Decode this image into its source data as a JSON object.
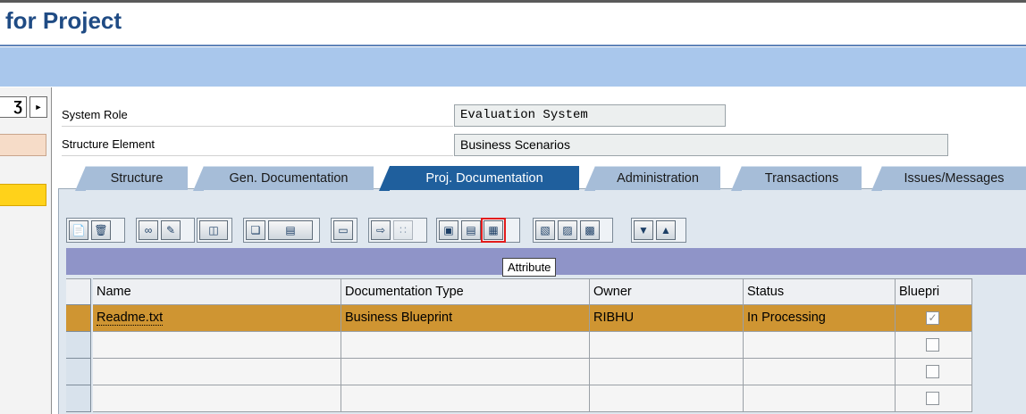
{
  "window": {
    "title": "for Project"
  },
  "fields": {
    "system_role": {
      "label": "System Role",
      "value": "Evaluation System"
    },
    "structure_element": {
      "label": "Structure Element",
      "value": "Business Scenarios"
    }
  },
  "tabs": [
    {
      "label": "Structure",
      "active": false
    },
    {
      "label": "Gen. Documentation",
      "active": false
    },
    {
      "label": "Proj. Documentation",
      "active": true
    },
    {
      "label": "Administration",
      "active": false
    },
    {
      "label": "Transactions",
      "active": false
    },
    {
      "label": "Issues/Messages",
      "active": false
    }
  ],
  "toolbar": {
    "tooltip": "Attribute",
    "icons": [
      "create-document-icon",
      "delete-document-icon",
      "display-icon",
      "edit-pencil-icon",
      "structure-icon",
      "copy-icon",
      "paste-icon",
      "delete-icon",
      "transfer-icon",
      "disabled-icon",
      "export-icon",
      "import-icon",
      "attribute-icon",
      "list-icon",
      "list-detail-icon",
      "details-icon",
      "move-down-icon",
      "move-up-icon"
    ]
  },
  "table": {
    "columns": [
      "Name",
      "Documentation Type",
      "Owner",
      "Status",
      "Bluepri"
    ],
    "rows": [
      {
        "name": "Readme.txt",
        "doc_type": "Business Blueprint",
        "owner": "RIBHU",
        "status": "In Processing",
        "blueprint": true
      },
      {
        "name": "",
        "doc_type": "",
        "owner": "",
        "status": "",
        "blueprint": false
      },
      {
        "name": "",
        "doc_type": "",
        "owner": "",
        "status": "",
        "blueprint": false
      },
      {
        "name": "",
        "doc_type": "",
        "owner": "",
        "status": "",
        "blueprint": false
      }
    ]
  },
  "colors": {
    "title": "#1f4b84",
    "app_bar": "#a9c7ec",
    "active_tab": "#1f5f9d",
    "inactive_tab": "#a6bdd8",
    "selected_row": "#cf9532",
    "table_band": "#8f94c8",
    "focus_outline": "#e21c1c"
  }
}
